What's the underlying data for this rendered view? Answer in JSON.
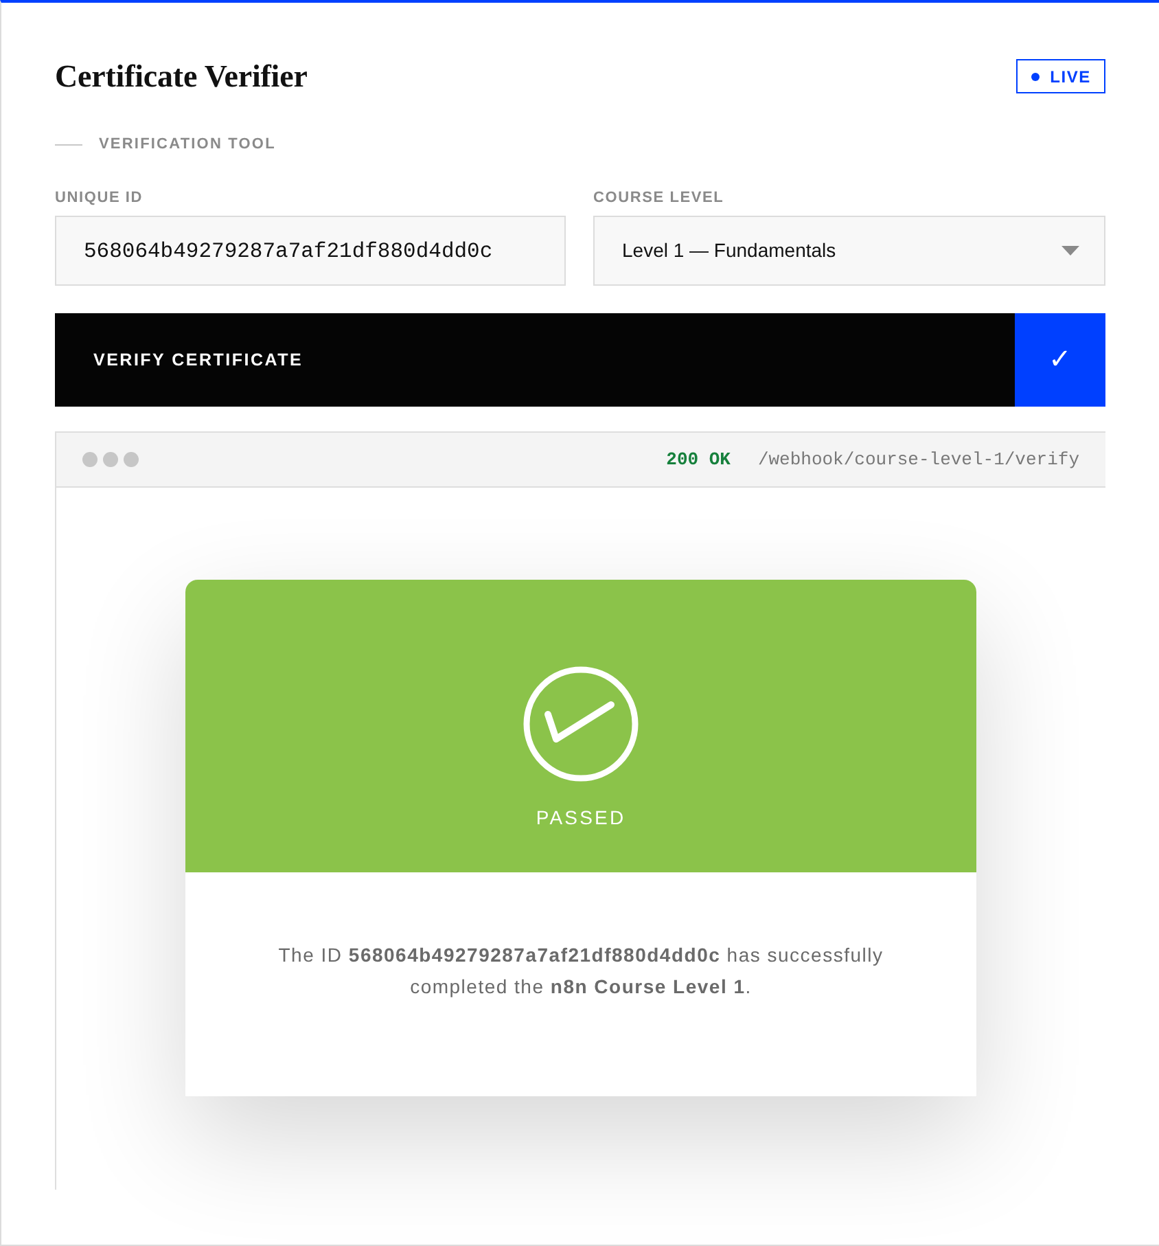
{
  "header": {
    "title": "Certificate Verifier",
    "badge": "LIVE"
  },
  "section_label": "VERIFICATION TOOL",
  "form": {
    "fields": [
      {
        "kind": "text",
        "label": "UNIQUE ID",
        "value": "568064b49279287a7af21df880d4dd0c"
      },
      {
        "kind": "select",
        "label": "COURSE LEVEL",
        "value": "Level 1 — Fundamentals"
      }
    ],
    "submit": {
      "label": "VERIFY CERTIFICATE",
      "icon": "✓"
    }
  },
  "response": {
    "status": {
      "text": "200 OK",
      "ok": true
    },
    "path": "/webhook/course-level-1/verify",
    "result": {
      "kind": "passed",
      "label": "PASSED",
      "message": "The ID **568064b49279287a7af21df880d4dd0c** has successfully completed the **n8n Course Level 1**."
    }
  }
}
